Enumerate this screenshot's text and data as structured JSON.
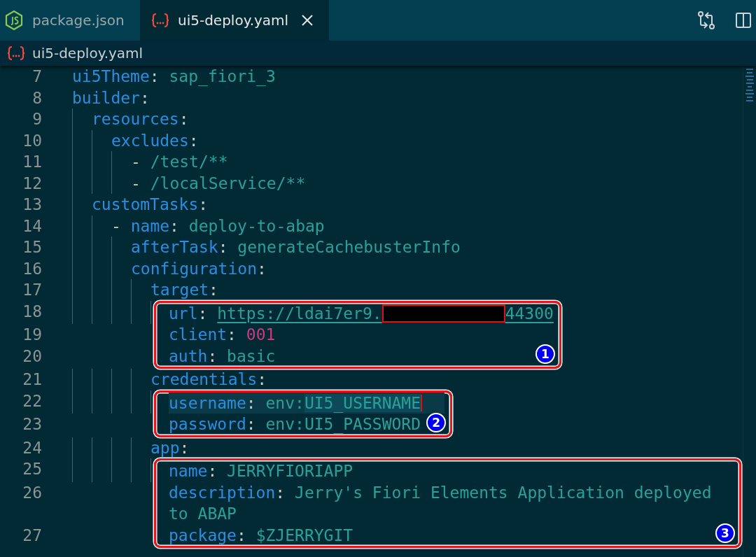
{
  "tabs": [
    {
      "label": "package.json",
      "kind": "js",
      "selected": false,
      "closable": false
    },
    {
      "label": "ui5-deploy.yaml",
      "kind": "yaml",
      "selected": true,
      "closable": true
    }
  ],
  "breadcrumb": {
    "label": "ui5-deploy.yaml",
    "kind": "yaml"
  },
  "lines": [
    {
      "number": "7",
      "key": "ui5Theme",
      "punct": ":",
      "value": "sap_fiori_3",
      "kind": "string"
    },
    {
      "number": "8",
      "key": "builder",
      "punct": ":",
      "children": [
        {
          "number": "9",
          "key": "resources",
          "punct": ":",
          "children": [
            {
              "number": "10",
              "key": "excludes",
              "punct": ":",
              "children": [
                {
                  "number": "11",
                  "marker": "-",
                  "value": "/test/**",
                  "kind": "string"
                },
                {
                  "number": "12",
                  "marker": "-",
                  "value": "/localService/**",
                  "kind": "string"
                }
              ]
            }
          ]
        },
        {
          "number": "13",
          "key": "customTasks",
          "punct": ":",
          "children": [
            {
              "number": "14",
              "marker": "-",
              "key": "name",
              "punct": ":",
              "value": "deploy-to-abap",
              "kind": "string",
              "children": [
                {
                  "number": "15",
                  "key": "afterTask",
                  "punct": ":",
                  "value": "generateCachebusterInfo",
                  "kind": "string"
                },
                {
                  "number": "16",
                  "key": "configuration",
                  "punct": ":",
                  "children": [
                    {
                      "number": "17",
                      "key": "target",
                      "punct": ":",
                      "frame": {
                        "badge": "1"
                      },
                      "children": [
                        {
                          "number": "18",
                          "key": "url",
                          "punct": ":",
                          "value": "https://ldai7er9.",
                          "kind": "link",
                          "redacted": true,
                          "value_end": "44300"
                        },
                        {
                          "number": "19",
                          "key": "client",
                          "punct": ":",
                          "value": "001",
                          "kind": "number"
                        },
                        {
                          "number": "20",
                          "key": "auth",
                          "punct": ":",
                          "value": "basic",
                          "kind": "string"
                        }
                      ]
                    },
                    {
                      "number": "21",
                      "key": "credentials",
                      "punct": ":",
                      "frame": {
                        "badge": "2"
                      },
                      "children": [
                        {
                          "number": "22",
                          "key": "username",
                          "punct": ":",
                          "value": "env:",
                          "kind": "string",
                          "match": "UI5_USERNAME",
                          "current": true,
                          "cursor": true
                        },
                        {
                          "number": "23",
                          "key": "password",
                          "punct": ":",
                          "value": "env:UI5_PASSWORD",
                          "kind": "string"
                        }
                      ]
                    },
                    {
                      "number": "24",
                      "key": "app",
                      "punct": ":",
                      "frame": {
                        "badge": "3"
                      },
                      "children": [
                        {
                          "number": "25",
                          "key": "name",
                          "punct": ":",
                          "value": "JERRYFIORIAPP",
                          "kind": "string"
                        },
                        {
                          "number": "26",
                          "key": "description",
                          "punct": ":",
                          "value": "Jerry's Fiori Elements Application deployed to ABAP",
                          "kind": "string"
                        },
                        {
                          "number": "27",
                          "key": "package",
                          "punct": ":",
                          "value": "$ZJERRYGIT",
                          "kind": "string"
                        }
                      ]
                    }
                  ]
                }
              ]
            }
          ]
        }
      ]
    }
  ]
}
